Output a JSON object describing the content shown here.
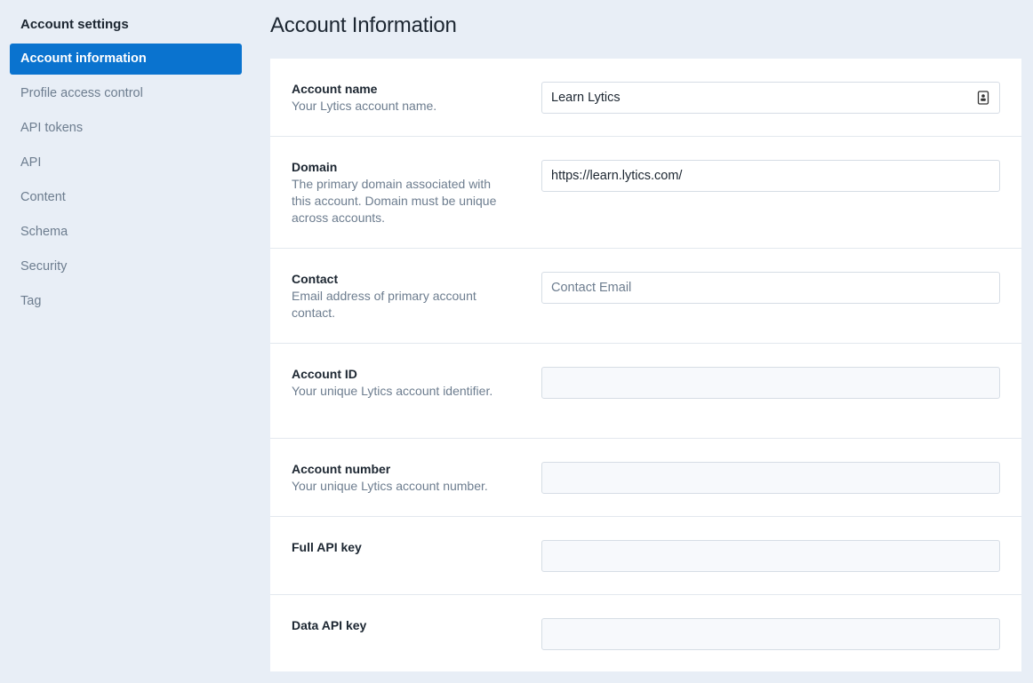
{
  "sidebar": {
    "heading": "Account settings",
    "items": [
      {
        "label": "Account information",
        "active": true
      },
      {
        "label": "Profile access control"
      },
      {
        "label": "API tokens"
      },
      {
        "label": "API"
      },
      {
        "label": "Content"
      },
      {
        "label": "Schema"
      },
      {
        "label": "Security"
      },
      {
        "label": "Tag"
      }
    ]
  },
  "main": {
    "title": "Account Information",
    "fields": {
      "account_name": {
        "label": "Account name",
        "help": "Your Lytics account name.",
        "value": "Learn Lytics",
        "icon": "contact-card-icon"
      },
      "domain": {
        "label": "Domain",
        "help": "The primary domain associated with this account. Domain must be unique across accounts.",
        "value": "https://learn.lytics.com/"
      },
      "contact": {
        "label": "Contact",
        "help": "Email address of primary account contact.",
        "placeholder": "Contact Email"
      },
      "account_id": {
        "label": "Account ID",
        "help": "Your unique Lytics account identifier."
      },
      "account_number": {
        "label": "Account number",
        "help": "Your unique Lytics account number."
      },
      "full_api_key": {
        "label": "Full API key"
      },
      "data_api_key": {
        "label": "Data API key"
      }
    }
  }
}
